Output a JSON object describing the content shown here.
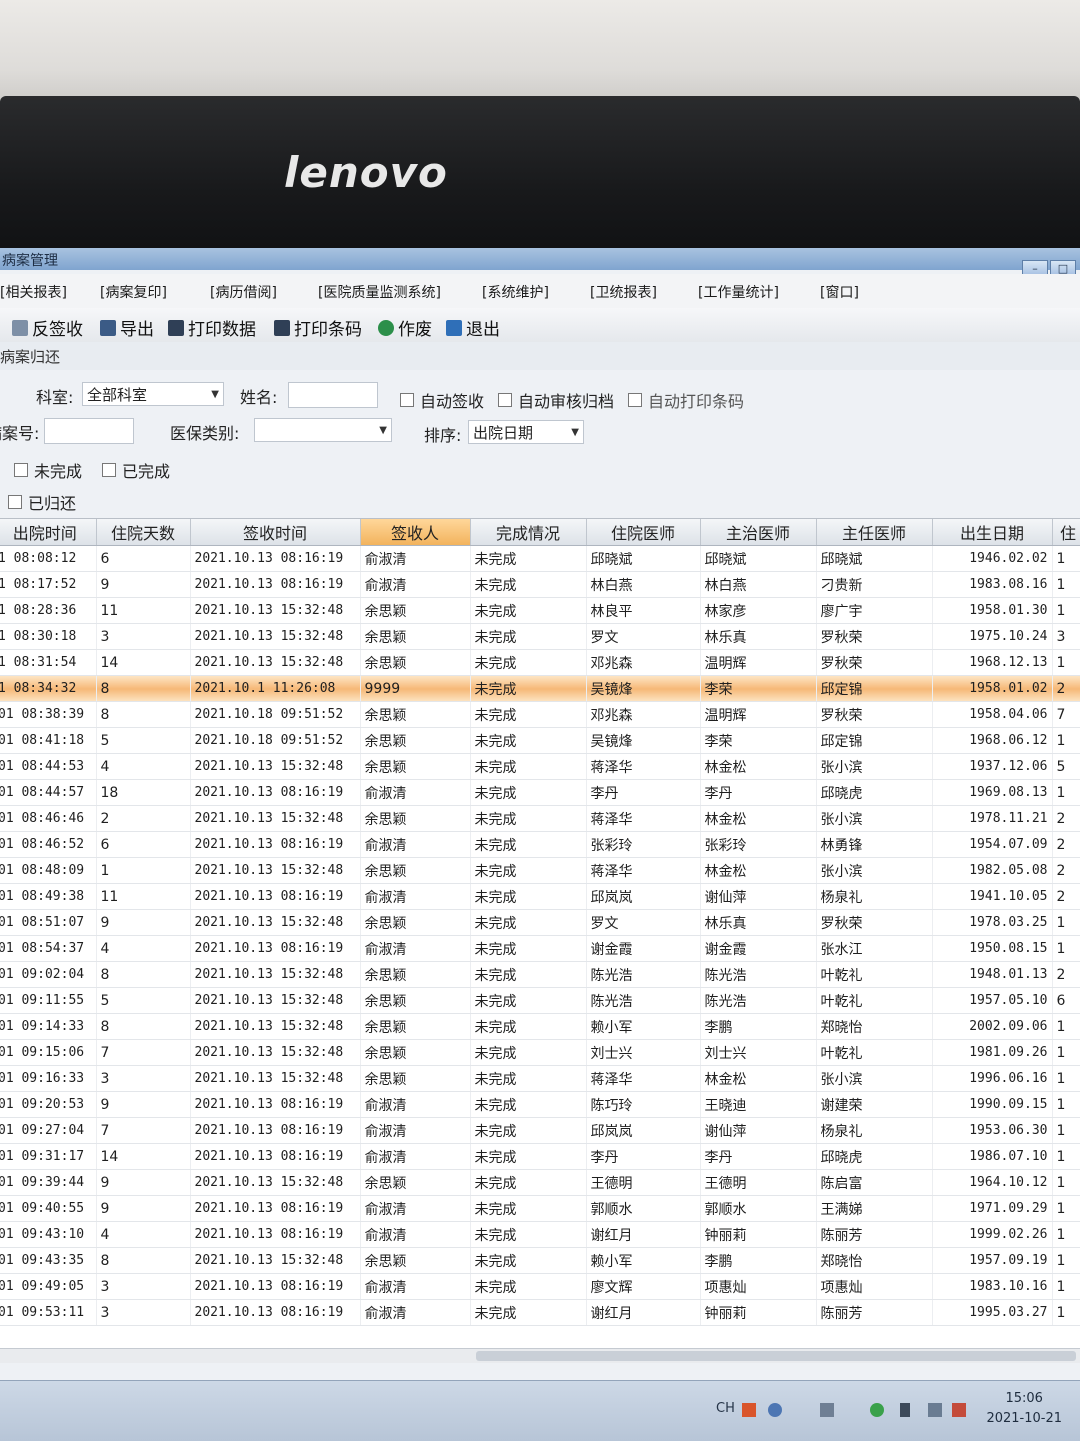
{
  "monitor": {
    "brand": "lenovo"
  },
  "window": {
    "title": "病案管理",
    "buttons": [
      "–",
      "□"
    ]
  },
  "menu": [
    "[相关报表]",
    "[病案复印]",
    "[病历借阅]",
    "[医院质量监测系统]",
    "[系统维护]",
    "[卫统报表]",
    "[工作量统计]",
    "[窗口]"
  ],
  "toolbar": {
    "unsign": "反签收",
    "export": "导出",
    "print_data": "打印数据",
    "print_barcode": "打印条码",
    "void": "作废",
    "exit": "退出"
  },
  "subtitle": "病案归还",
  "filters": {
    "dept_label": "科室:",
    "dept_value": "全部科室",
    "name_label": "姓名:",
    "auto_sign": "自动签收",
    "auto_review": "自动审核归档",
    "auto_print": "自动打印条码",
    "case_no_label": "病案号:",
    "insurance_label": "医保类别:",
    "sort_label": "排序:",
    "sort_value": "出院日期",
    "unfinished": "未完成",
    "finished": "已完成",
    "returned": "已归还"
  },
  "table": {
    "columns": [
      "出院时间",
      "住院天数",
      "签收时间",
      "签收人",
      "完成情况",
      "住院医师",
      "主治医师",
      "主任医师",
      "出生日期",
      "住"
    ],
    "sorted_column": "签收人",
    "selected_row_index": 5,
    "rows": [
      [
        "1 08:08:12",
        "6",
        "2021.10.13 08:16:19",
        "俞淑清",
        "未完成",
        "邱晓斌",
        "邱晓斌",
        "邱晓斌",
        "1946.02.02",
        "1"
      ],
      [
        "1 08:17:52",
        "9",
        "2021.10.13 08:16:19",
        "俞淑清",
        "未完成",
        "林白燕",
        "林白燕",
        "刁贵新",
        "1983.08.16",
        "1"
      ],
      [
        "1 08:28:36",
        "11",
        "2021.10.13 15:32:48",
        "余思颖",
        "未完成",
        "林良平",
        "林家彦",
        "廖广宇",
        "1958.01.30",
        "1"
      ],
      [
        "1 08:30:18",
        "3",
        "2021.10.13 15:32:48",
        "余思颖",
        "未完成",
        "罗文",
        "林乐真",
        "罗秋荣",
        "1975.10.24",
        "3"
      ],
      [
        "1 08:31:54",
        "14",
        "2021.10.13 15:32:48",
        "余思颖",
        "未完成",
        "邓兆森",
        "温明辉",
        "罗秋荣",
        "1968.12.13",
        "1"
      ],
      [
        "1 08:34:32",
        "8",
        "2021.10.1 11:26:08",
        "9999",
        "未完成",
        "吴镜烽",
        "李荣",
        "邱定锦",
        "1958.01.02",
        "2"
      ],
      [
        "01 08:38:39",
        "8",
        "2021.10.18 09:51:52",
        "余思颖",
        "未完成",
        "邓兆森",
        "温明辉",
        "罗秋荣",
        "1958.04.06",
        "7"
      ],
      [
        "01 08:41:18",
        "5",
        "2021.10.18 09:51:52",
        "余思颖",
        "未完成",
        "吴镜烽",
        "李荣",
        "邱定锦",
        "1968.06.12",
        "1"
      ],
      [
        "01 08:44:53",
        "4",
        "2021.10.13 15:32:48",
        "余思颖",
        "未完成",
        "蒋泽华",
        "林金松",
        "张小滨",
        "1937.12.06",
        "5"
      ],
      [
        "01 08:44:57",
        "18",
        "2021.10.13 08:16:19",
        "俞淑清",
        "未完成",
        "李丹",
        "李丹",
        "邱晓虎",
        "1969.08.13",
        "1"
      ],
      [
        "01 08:46:46",
        "2",
        "2021.10.13 15:32:48",
        "余思颖",
        "未完成",
        "蒋泽华",
        "林金松",
        "张小滨",
        "1978.11.21",
        "2"
      ],
      [
        "01 08:46:52",
        "6",
        "2021.10.13 08:16:19",
        "俞淑清",
        "未完成",
        "张彩玲",
        "张彩玲",
        "林勇锋",
        "1954.07.09",
        "2"
      ],
      [
        "01 08:48:09",
        "1",
        "2021.10.13 15:32:48",
        "余思颖",
        "未完成",
        "蒋泽华",
        "林金松",
        "张小滨",
        "1982.05.08",
        "2"
      ],
      [
        "01 08:49:38",
        "11",
        "2021.10.13 08:16:19",
        "俞淑清",
        "未完成",
        "邱岚岚",
        "谢仙萍",
        "杨泉礼",
        "1941.10.05",
        "2"
      ],
      [
        "01 08:51:07",
        "9",
        "2021.10.13 15:32:48",
        "余思颖",
        "未完成",
        "罗文",
        "林乐真",
        "罗秋荣",
        "1978.03.25",
        "1"
      ],
      [
        "01 08:54:37",
        "4",
        "2021.10.13 08:16:19",
        "俞淑清",
        "未完成",
        "谢金霞",
        "谢金霞",
        "张水江",
        "1950.08.15",
        "1"
      ],
      [
        "01 09:02:04",
        "8",
        "2021.10.13 15:32:48",
        "余思颖",
        "未完成",
        "陈光浩",
        "陈光浩",
        "叶乾礼",
        "1948.01.13",
        "2"
      ],
      [
        "01 09:11:55",
        "5",
        "2021.10.13 15:32:48",
        "余思颖",
        "未完成",
        "陈光浩",
        "陈光浩",
        "叶乾礼",
        "1957.05.10",
        "6"
      ],
      [
        "01 09:14:33",
        "8",
        "2021.10.13 15:32:48",
        "余思颖",
        "未完成",
        "赖小军",
        "李鹏",
        "郑晓怡",
        "2002.09.06",
        "1"
      ],
      [
        "01 09:15:06",
        "7",
        "2021.10.13 15:32:48",
        "余思颖",
        "未完成",
        "刘士兴",
        "刘士兴",
        "叶乾礼",
        "1981.09.26",
        "1"
      ],
      [
        "01 09:16:33",
        "3",
        "2021.10.13 15:32:48",
        "余思颖",
        "未完成",
        "蒋泽华",
        "林金松",
        "张小滨",
        "1996.06.16",
        "1"
      ],
      [
        "01 09:20:53",
        "9",
        "2021.10.13 08:16:19",
        "俞淑清",
        "未完成",
        "陈巧玲",
        "王晓迪",
        "谢建荣",
        "1990.09.15",
        "1"
      ],
      [
        "01 09:27:04",
        "7",
        "2021.10.13 08:16:19",
        "俞淑清",
        "未完成",
        "邱岚岚",
        "谢仙萍",
        "杨泉礼",
        "1953.06.30",
        "1"
      ],
      [
        "01 09:31:17",
        "14",
        "2021.10.13 08:16:19",
        "俞淑清",
        "未完成",
        "李丹",
        "李丹",
        "邱晓虎",
        "1986.07.10",
        "1"
      ],
      [
        "01 09:39:44",
        "9",
        "2021.10.13 15:32:48",
        "余思颖",
        "未完成",
        "王德明",
        "王德明",
        "陈启富",
        "1964.10.12",
        "1"
      ],
      [
        "01 09:40:55",
        "9",
        "2021.10.13 08:16:19",
        "俞淑清",
        "未完成",
        "郭顺水",
        "郭顺水",
        "王满娣",
        "1971.09.29",
        "1"
      ],
      [
        "01 09:43:10",
        "4",
        "2021.10.13 08:16:19",
        "俞淑清",
        "未完成",
        "谢红月",
        "钟丽莉",
        "陈丽芳",
        "1999.02.26",
        "1"
      ],
      [
        "01 09:43:35",
        "8",
        "2021.10.13 15:32:48",
        "余思颖",
        "未完成",
        "赖小军",
        "李鹏",
        "郑晓怡",
        "1957.09.19",
        "1"
      ],
      [
        "01 09:49:05",
        "3",
        "2021.10.13 08:16:19",
        "俞淑清",
        "未完成",
        "廖文辉",
        "项惠灿",
        "项惠灿",
        "1983.10.16",
        "1"
      ],
      [
        "01 09:53:11",
        "3",
        "2021.10.13 08:16:19",
        "俞淑清",
        "未完成",
        "谢红月",
        "钟丽莉",
        "陈丽芳",
        "1995.03.27",
        "1"
      ]
    ]
  },
  "taskbar": {
    "lang": "CH",
    "time": "15:06",
    "date": "2021-10-21"
  }
}
